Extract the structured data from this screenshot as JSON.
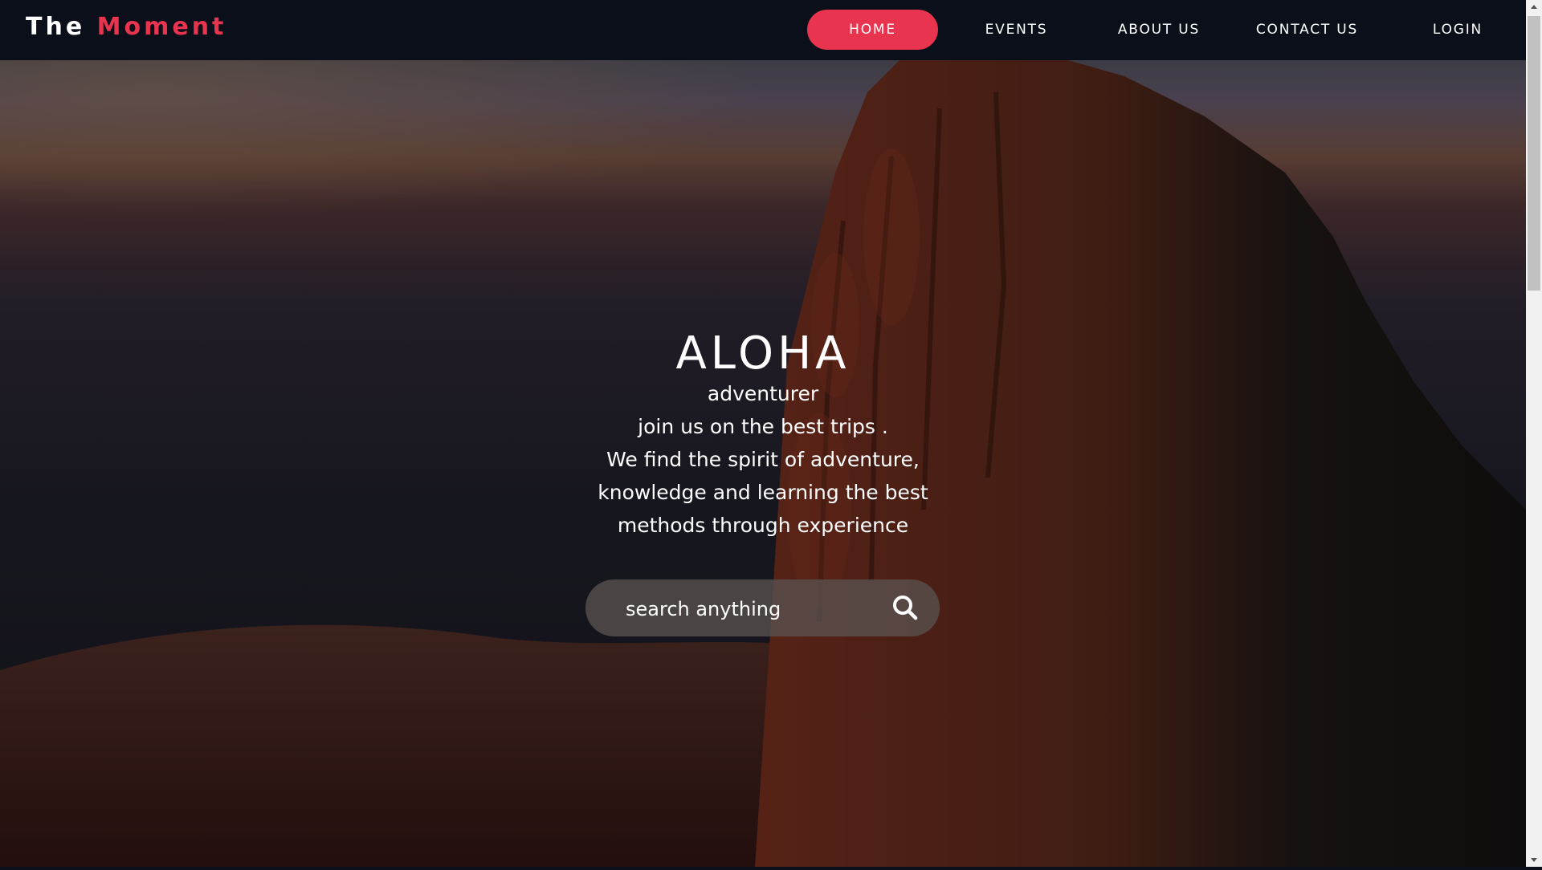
{
  "brand": {
    "name_part1": "The",
    "name_part2": "Moment",
    "accent_color": "#e8344e"
  },
  "nav": {
    "items": [
      {
        "label": "HOME",
        "active": true
      },
      {
        "label": "EVENTS",
        "active": false
      },
      {
        "label": "ABOUT US",
        "active": false
      },
      {
        "label": "CONTACT US",
        "active": false
      },
      {
        "label": "LOGIN",
        "active": false
      }
    ]
  },
  "hero": {
    "title": "ALOHA",
    "lines": [
      "adventurer",
      "join us on the best trips .",
      "We find the spirit of adventure,",
      "knowledge and learning the best",
      "methods through experience"
    ],
    "background": "aerial view of rocky mountain at sunset over the sea"
  },
  "search": {
    "placeholder": "search anything",
    "value": "",
    "icon": "search-icon"
  },
  "colors": {
    "navbar_bg": "#0a0f1a",
    "text": "#ffffff",
    "search_bg": "#5a5250"
  }
}
